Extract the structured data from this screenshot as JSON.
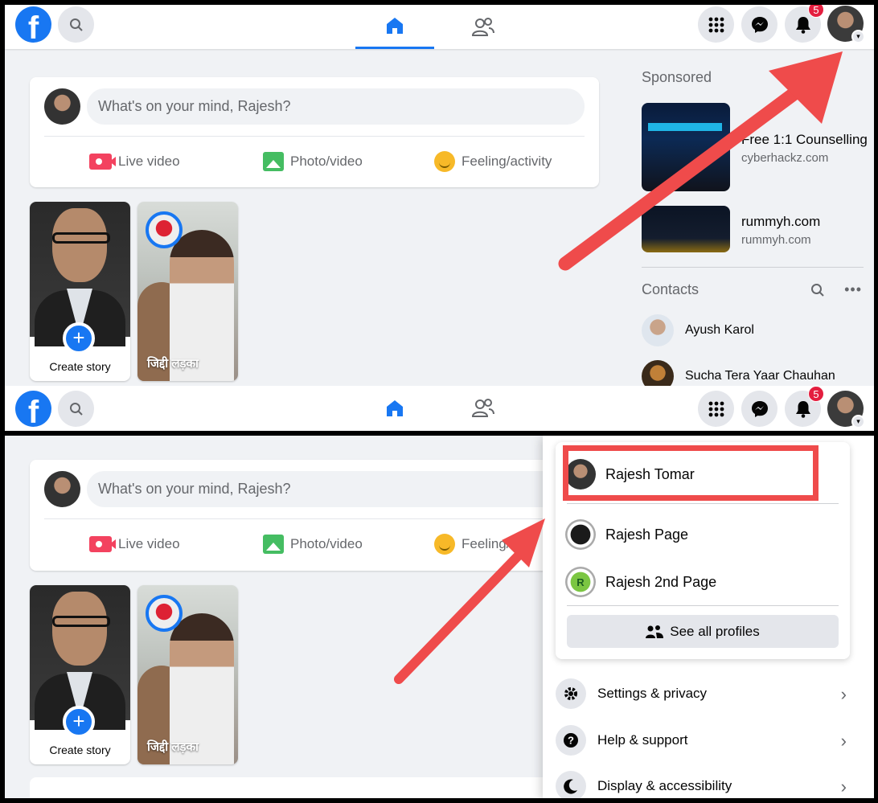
{
  "brand": {
    "logo_letter": "f",
    "accent": "#1877f2",
    "annotation_color": "#ef4b4b"
  },
  "topbar": {
    "notification_count": "5",
    "icons": [
      "search-icon",
      "home-icon",
      "friends-icon",
      "menu-grid-icon",
      "messenger-icon",
      "bell-icon",
      "chevron-down-icon"
    ]
  },
  "composer": {
    "placeholder": "What's on your mind, Rajesh?",
    "live_label": "Live video",
    "photo_label": "Photo/video",
    "feeling_label": "Feeling/activity",
    "feeling_label_truncated": "Feeling/"
  },
  "stories": {
    "create_label": "Create story",
    "plus": "+",
    "friend_label": "जिद्दी लड़का"
  },
  "sidebar": {
    "sponsored_title": "Sponsored",
    "ads": [
      {
        "title": "Free 1:1 Counselling",
        "url": "cyberhackz.com"
      },
      {
        "title": "rummyh.com",
        "url": "rummyh.com"
      }
    ],
    "contacts_title": "Contacts",
    "more": "•••",
    "contacts": [
      "Ayush Karol",
      "Sucha Tera Yaar Chauhan"
    ]
  },
  "account_menu": {
    "profile_name": "Rajesh Tomar",
    "pages": [
      "Rajesh Page",
      "Rajesh 2nd Page"
    ],
    "page2_initial": "R",
    "see_all_label": "See all profiles",
    "items": [
      "Settings & privacy",
      "Help & support",
      "Display & accessibility"
    ],
    "chevron": "›"
  }
}
